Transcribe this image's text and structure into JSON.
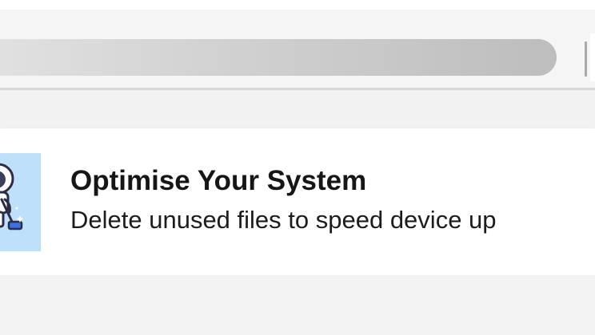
{
  "toolbar": {
    "search_placeholder": ""
  },
  "notification": {
    "title": "Optimise Your System",
    "subtitle": "Delete unused files to speed device up",
    "icon": "astronaut-vacuum-cleaner-icon"
  },
  "colors": {
    "icon_background": "#bfe0fb",
    "card_background": "#ffffff",
    "page_background": "#f3f3f3"
  }
}
